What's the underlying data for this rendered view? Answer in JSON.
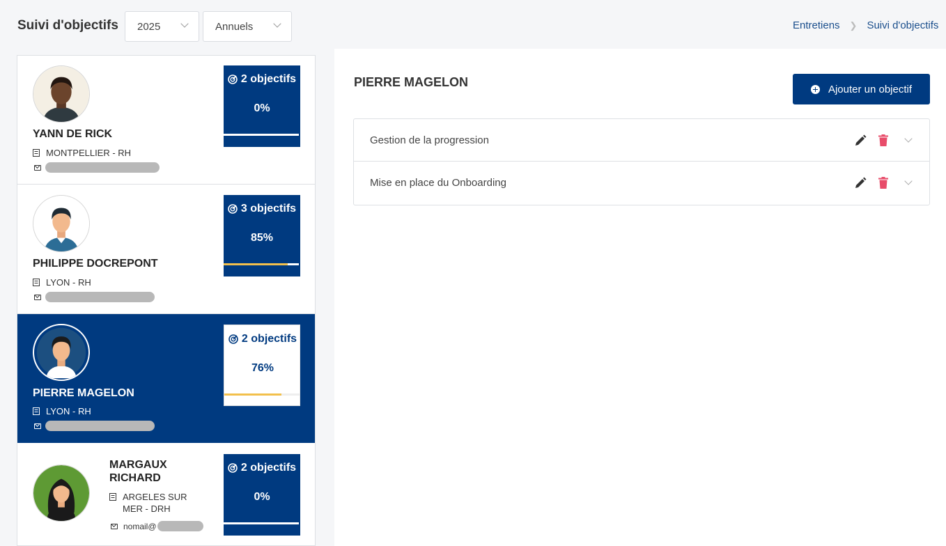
{
  "header": {
    "title": "Suivi d'objectifs",
    "year_select": "2025",
    "period_select": "Annuels",
    "breadcrumb": [
      "Entretiens",
      "Suivi d'objectifs"
    ]
  },
  "employees": [
    {
      "name": "YANN DE RICK",
      "location": "MONTPELLIER - RH",
      "email": "",
      "objectives": "2 objectifs",
      "progress": "0%",
      "progress_value": 0,
      "selected": false
    },
    {
      "name": "PHILIPPE DOCREPONT",
      "location": "LYON - RH",
      "email": "",
      "objectives": "3 objectifs",
      "progress": "85%",
      "progress_value": 85,
      "selected": false
    },
    {
      "name": "PIERRE MAGELON",
      "location": "LYON - RH",
      "email": "",
      "objectives": "2 objectifs",
      "progress": "76%",
      "progress_value": 76,
      "selected": true
    },
    {
      "name": "MARGAUX RICHARD",
      "location": "ARGELES SUR MER - DRH",
      "email": "nomail@",
      "objectives": "2 objectifs",
      "progress": "0%",
      "progress_value": 0,
      "selected": false
    }
  ],
  "detail": {
    "title": "PIERRE MAGELON",
    "add_button": "Ajouter un objectif",
    "objectives": [
      {
        "label": "Gestion de la progression"
      },
      {
        "label": "Mise en place du Onboarding"
      }
    ]
  },
  "icons": [
    "target-icon",
    "building-icon",
    "mail-icon",
    "pencil-icon",
    "trash-icon",
    "chevron-down-icon",
    "plus-circle-icon"
  ],
  "colors": {
    "primary": "#003a80",
    "progress": "#f2c04c",
    "danger": "#e84c6a"
  }
}
